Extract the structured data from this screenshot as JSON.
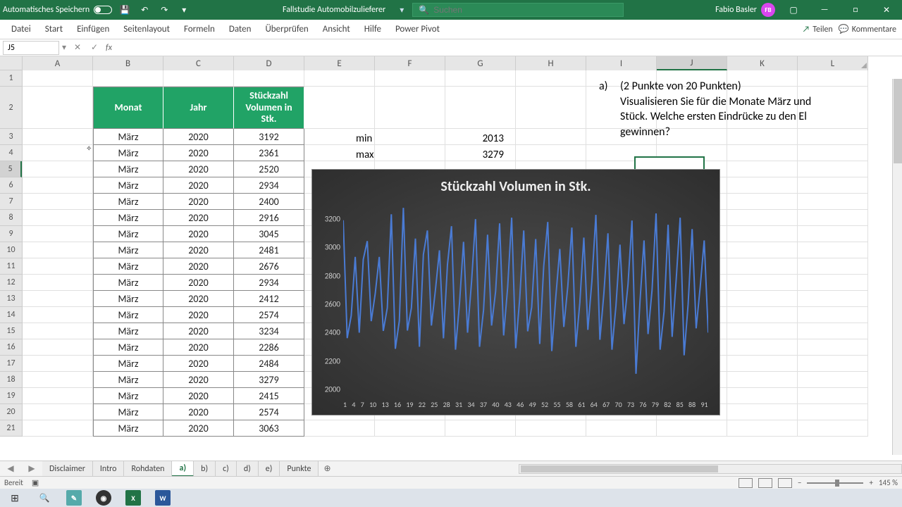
{
  "titlebar": {
    "autosave": "Automatisches Speichern",
    "doc": "Fallstudie Automobilzulieferer",
    "search_placeholder": "Suchen",
    "user": "Fabio Basler",
    "initials": "FB"
  },
  "ribbon": {
    "tabs": [
      "Datei",
      "Start",
      "Einfügen",
      "Seitenlayout",
      "Formeln",
      "Daten",
      "Überprüfen",
      "Ansicht",
      "Hilfe",
      "Power Pivot"
    ],
    "share": "Teilen",
    "comments": "Kommentare"
  },
  "fx": {
    "cellref": "J5"
  },
  "cols": [
    "A",
    "B",
    "C",
    "D",
    "E",
    "F",
    "G",
    "H",
    "I",
    "J",
    "K",
    "L"
  ],
  "table": {
    "headers": [
      "Monat",
      "Jahr",
      "Stückzahl Volumen in Stk."
    ],
    "rows": [
      [
        "März",
        "2020",
        "3192"
      ],
      [
        "März",
        "2020",
        "2361"
      ],
      [
        "März",
        "2020",
        "2520"
      ],
      [
        "März",
        "2020",
        "2934"
      ],
      [
        "März",
        "2020",
        "2400"
      ],
      [
        "März",
        "2020",
        "2916"
      ],
      [
        "März",
        "2020",
        "3045"
      ],
      [
        "März",
        "2020",
        "2481"
      ],
      [
        "März",
        "2020",
        "2676"
      ],
      [
        "März",
        "2020",
        "2934"
      ],
      [
        "März",
        "2020",
        "2412"
      ],
      [
        "März",
        "2020",
        "2574"
      ],
      [
        "März",
        "2020",
        "3234"
      ],
      [
        "März",
        "2020",
        "2286"
      ],
      [
        "März",
        "2020",
        "2484"
      ],
      [
        "März",
        "2020",
        "3279"
      ],
      [
        "März",
        "2020",
        "2415"
      ],
      [
        "März",
        "2020",
        "2574"
      ],
      [
        "März",
        "2020",
        "3063"
      ]
    ]
  },
  "stats": {
    "min_label": "min",
    "min_val": "2013",
    "max_label": "max",
    "max_val": "3279"
  },
  "question": {
    "letter": "a)",
    "line1": "(2 Punkte von 20 Punkten)",
    "line2": "Visualisieren Sie für die Monate März und",
    "line3": "Stück. Welche ersten Eindrücke zu den El",
    "line4": "gewinnen?"
  },
  "chart_data": {
    "type": "line",
    "title": "Stückzahl Volumen in Stk.",
    "xlabel": "",
    "ylabel": "",
    "ylim": [
      2000,
      3300
    ],
    "yticks": [
      2000,
      2200,
      2400,
      2600,
      2800,
      3000,
      3200
    ],
    "x_tick_labels": [
      "1",
      "4",
      "7",
      "10",
      "13",
      "16",
      "19",
      "22",
      "25",
      "28",
      "31",
      "34",
      "37",
      "40",
      "43",
      "46",
      "49",
      "52",
      "55",
      "58",
      "61",
      "64",
      "67",
      "70",
      "73",
      "76",
      "79",
      "82",
      "85",
      "88",
      "91"
    ],
    "x": [
      1,
      2,
      3,
      4,
      5,
      6,
      7,
      8,
      9,
      10,
      11,
      12,
      13,
      14,
      15,
      16,
      17,
      18,
      19,
      20,
      21,
      22,
      23,
      24,
      25,
      26,
      27,
      28,
      29,
      30,
      31,
      32,
      33,
      34,
      35,
      36,
      37,
      38,
      39,
      40,
      41,
      42,
      43,
      44,
      45,
      46,
      47,
      48,
      49,
      50,
      51,
      52,
      53,
      54,
      55,
      56,
      57,
      58,
      59,
      60,
      61,
      62,
      63,
      64,
      65,
      66,
      67,
      68,
      69,
      70,
      71,
      72,
      73,
      74,
      75,
      76,
      77,
      78,
      79,
      80,
      81,
      82,
      83,
      84,
      85,
      86,
      87,
      88,
      89,
      90,
      91,
      92
    ],
    "values": [
      3192,
      2361,
      2520,
      2934,
      2400,
      2916,
      3045,
      2481,
      2676,
      2934,
      2412,
      2574,
      3234,
      2286,
      2484,
      3279,
      2415,
      2574,
      3063,
      2300,
      2950,
      3120,
      2450,
      2700,
      2980,
      2360,
      2880,
      3150,
      2280,
      2610,
      3040,
      2400,
      2760,
      3200,
      2300,
      2560,
      3090,
      2450,
      2690,
      3170,
      2380,
      2720,
      3210,
      2290,
      2640,
      3120,
      2410,
      2580,
      3060,
      2320,
      2870,
      3180,
      2270,
      2650,
      2990,
      2440,
      2730,
      3140,
      2300,
      2610,
      3070,
      2420,
      2760,
      3230,
      2350,
      2680,
      3100,
      2280,
      2590,
      3020,
      2460,
      2740,
      3190,
      2110,
      2620,
      3050,
      2390,
      2700,
      3240,
      2280,
      2550,
      3160,
      2370,
      2770,
      3210,
      2240,
      2600,
      3130,
      2430,
      2720,
      3050,
      2400
    ]
  },
  "sheets": [
    "Disclaimer",
    "Intro",
    "Rohdaten",
    "a)",
    "b)",
    "c)",
    "d)",
    "e)",
    "Punkte"
  ],
  "active_sheet": "a)",
  "status": {
    "ready": "Bereit",
    "zoom": "145 %"
  }
}
